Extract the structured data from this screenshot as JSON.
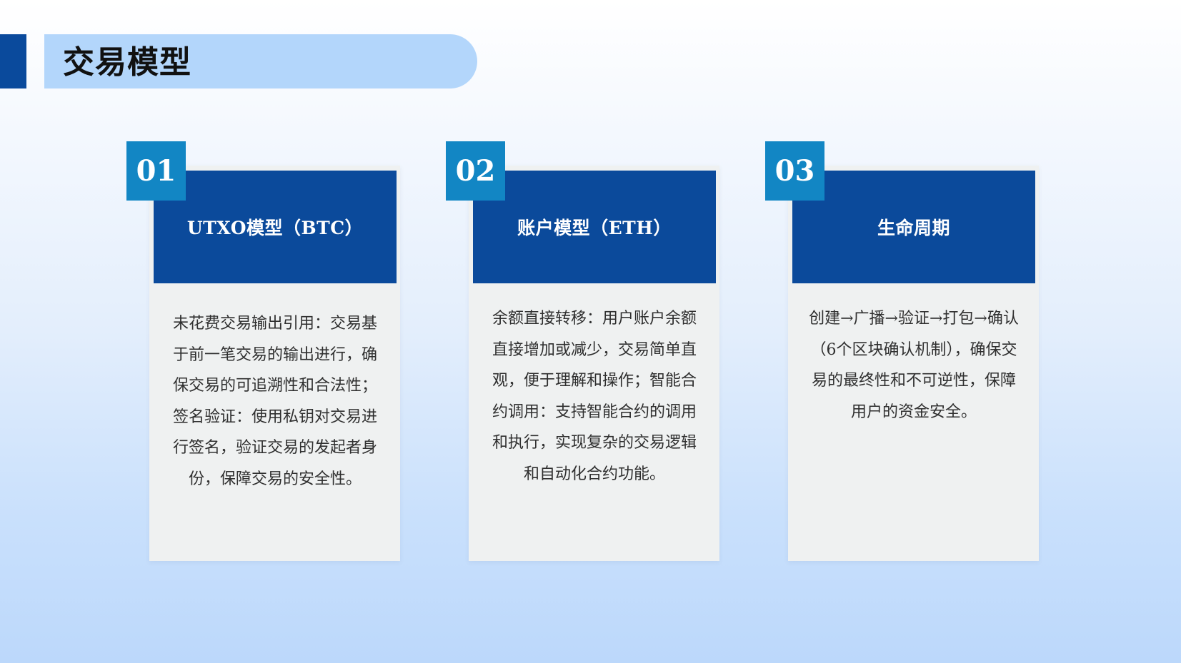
{
  "header": {
    "title": "交易模型"
  },
  "colors": {
    "accent": "#0a4a9c",
    "title_pill": "#b3d6fb",
    "card_header": "#0b4a9b",
    "badge": "#1286c4",
    "card_body_bg": "#eff1f1"
  },
  "cards": [
    {
      "number": "01",
      "title": "UTXO模型（BTC）",
      "body": "未花费交易输出引用：交易基于前一笔交易的输出进行，确保交易的可追溯性和合法性；签名验证：使用私钥对交易进行签名，验证交易的发起者身份，保障交易的安全性。"
    },
    {
      "number": "02",
      "title": "账户模型（ETH）",
      "body": "余额直接转移：用户账户余额直接增加或减少，交易简单直观，便于理解和操作；智能合约调用：支持智能合约的调用和执行，实现复杂的交易逻辑和自动化合约功能。"
    },
    {
      "number": "03",
      "title": "生命周期",
      "body": "创建→广播→验证→打包→确认（6个区块确认机制），确保交易的最终性和不可逆性，保障用户的资金安全。"
    }
  ]
}
